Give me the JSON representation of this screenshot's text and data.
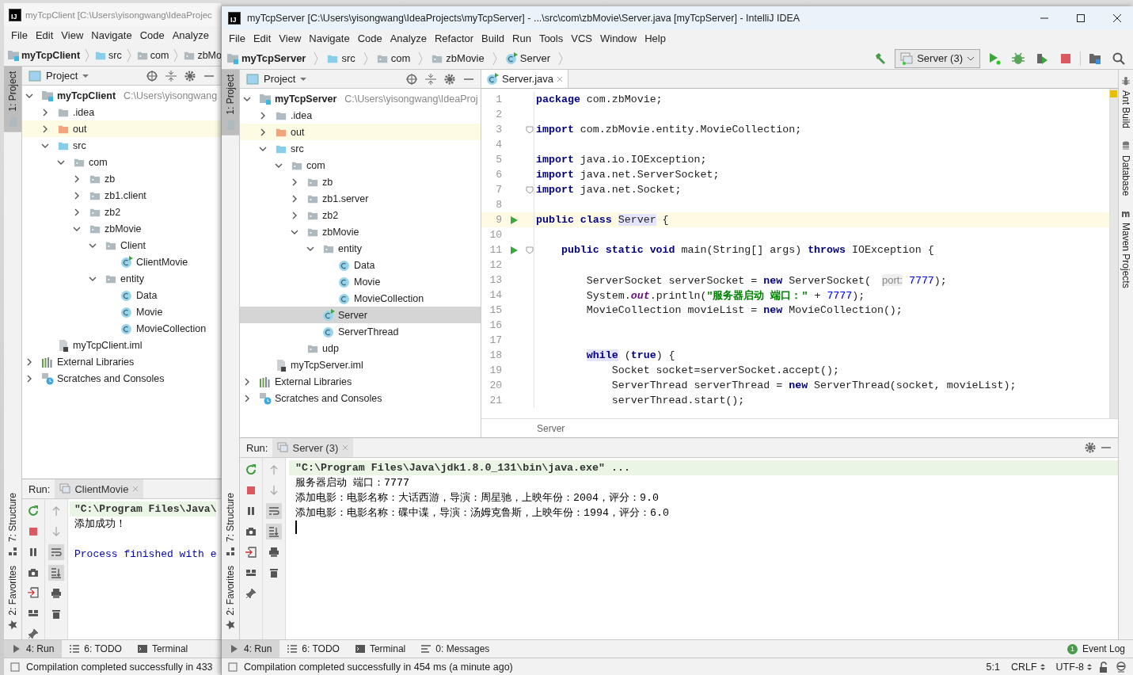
{
  "back_window": {
    "logo_text": "IJ",
    "title": "myTcpClient [C:\\Users\\yisongwang\\IdeaProjec",
    "menu": [
      "File",
      "Edit",
      "View",
      "Navigate",
      "Code",
      "Analyze"
    ],
    "breadcrumbs": [
      {
        "label": "myTcpClient",
        "kind": "module"
      },
      {
        "label": "src",
        "kind": "source"
      },
      {
        "label": "com",
        "kind": "package"
      },
      {
        "label": "zbMo",
        "kind": "package"
      }
    ],
    "side_tabs": [
      {
        "label": "1: Project",
        "kind": "folder",
        "selected": true
      },
      {
        "label": "7: Structure",
        "kind": "structure",
        "selected": false
      },
      {
        "label": "2: Favorites",
        "kind": "star",
        "selected": false
      }
    ],
    "project_panel": {
      "title": "Project"
    },
    "project_tree": [
      {
        "label": "myTcpClient",
        "kind": "module",
        "expanded": true,
        "hint": "C:\\Users\\yisongwang",
        "children": [
          {
            "label": ".idea",
            "kind": "folder",
            "expanded": false
          },
          {
            "label": "out",
            "kind": "excluded",
            "expanded": false
          },
          {
            "label": "src",
            "kind": "source",
            "expanded": true,
            "children": [
              {
                "label": "com",
                "kind": "package",
                "expanded": true,
                "children": [
                  {
                    "label": "zb",
                    "kind": "package",
                    "expanded": false
                  },
                  {
                    "label": "zb1.client",
                    "kind": "package",
                    "expanded": false
                  },
                  {
                    "label": "zb2",
                    "kind": "package",
                    "expanded": false
                  },
                  {
                    "label": "zbMovie",
                    "kind": "package",
                    "expanded": true,
                    "children": [
                      {
                        "label": "Client",
                        "kind": "package",
                        "expanded": true,
                        "children": [
                          {
                            "label": "ClientMovie",
                            "kind": "run-class"
                          }
                        ]
                      },
                      {
                        "label": "entity",
                        "kind": "package",
                        "expanded": true,
                        "children": [
                          {
                            "label": "Data",
                            "kind": "class"
                          },
                          {
                            "label": "Movie",
                            "kind": "class"
                          },
                          {
                            "label": "MovieCollection",
                            "kind": "class"
                          }
                        ]
                      }
                    ]
                  }
                ]
              }
            ]
          },
          {
            "label": "myTcpClient.iml",
            "kind": "iml"
          }
        ]
      },
      {
        "label": "External Libraries",
        "kind": "libraries",
        "expanded": false
      },
      {
        "label": "Scratches and Consoles",
        "kind": "scratches",
        "expanded": false
      }
    ],
    "run_panel": {
      "label": "Run:",
      "tab": "ClientMovie"
    },
    "console": [
      {
        "text": "\"C:\\Program Files\\Java\\",
        "kind": "command"
      },
      {
        "text": "添加成功！",
        "kind": "output"
      },
      {
        "text": "Process finished with e",
        "kind": "process"
      }
    ],
    "bottom_tabs": [
      {
        "label": "4: Run",
        "kind": "run",
        "selected": true
      },
      {
        "label": "6: TODO",
        "kind": "todo",
        "selected": false
      },
      {
        "label": "Terminal",
        "kind": "terminal",
        "selected": false
      }
    ],
    "status": "Compilation completed successfully in 433"
  },
  "front_window": {
    "logo_text": "IJ",
    "title": "myTcpServer [C:\\Users\\yisongwang\\IdeaProjects\\myTcpServer] - ...\\src\\com\\zbMovie\\Server.java [myTcpServer] - IntelliJ IDEA",
    "menu": [
      "File",
      "Edit",
      "View",
      "Navigate",
      "Code",
      "Analyze",
      "Refactor",
      "Build",
      "Run",
      "Tools",
      "VCS",
      "Window",
      "Help"
    ],
    "breadcrumbs": [
      {
        "label": "myTcpServer",
        "kind": "module"
      },
      {
        "label": "src",
        "kind": "source"
      },
      {
        "label": "com",
        "kind": "package"
      },
      {
        "label": "zbMovie",
        "kind": "package"
      },
      {
        "label": "Server",
        "kind": "run-class"
      }
    ],
    "run_config": "Server (3)",
    "side_tabs": [
      {
        "label": "1: Project",
        "kind": "folder",
        "selected": true
      },
      {
        "label": "7: Structure",
        "kind": "structure",
        "selected": false
      },
      {
        "label": "2: Favorites",
        "kind": "star",
        "selected": false
      }
    ],
    "right_tabs": [
      {
        "label": "Ant Build",
        "kind": "ant"
      },
      {
        "label": "Database",
        "kind": "database"
      },
      {
        "label": "Maven Projects",
        "kind": "maven"
      }
    ],
    "project_panel": {
      "title": "Project"
    },
    "project_tree": [
      {
        "label": "myTcpServer",
        "kind": "module",
        "expanded": true,
        "selected": false,
        "hint": "C:\\Users\\yisongwang\\IdeaProj",
        "children": [
          {
            "label": ".idea",
            "kind": "folder",
            "expanded": false,
            "selected": false
          },
          {
            "label": "out",
            "kind": "excluded",
            "expanded": false,
            "selected": false
          },
          {
            "label": "src",
            "kind": "source",
            "expanded": true,
            "selected": false,
            "children": [
              {
                "label": "com",
                "kind": "package",
                "expanded": true,
                "selected": false,
                "children": [
                  {
                    "label": "zb",
                    "kind": "package",
                    "expanded": false,
                    "selected": false
                  },
                  {
                    "label": "zb1.server",
                    "kind": "package",
                    "expanded": false,
                    "selected": false
                  },
                  {
                    "label": "zb2",
                    "kind": "package",
                    "expanded": false,
                    "selected": false
                  },
                  {
                    "label": "zbMovie",
                    "kind": "package",
                    "expanded": true,
                    "selected": false,
                    "children": [
                      {
                        "label": "entity",
                        "kind": "package",
                        "expanded": true,
                        "selected": false,
                        "children": [
                          {
                            "label": "Data",
                            "kind": "class",
                            "selected": false
                          },
                          {
                            "label": "Movie",
                            "kind": "class",
                            "selected": false
                          },
                          {
                            "label": "MovieCollection",
                            "kind": "class",
                            "selected": false
                          }
                        ]
                      },
                      {
                        "label": "Server",
                        "kind": "run-class",
                        "selected": true
                      },
                      {
                        "label": "ServerThread",
                        "kind": "class",
                        "selected": false
                      }
                    ]
                  },
                  {
                    "label": "udp",
                    "kind": "package",
                    "selected": false
                  }
                ]
              }
            ]
          },
          {
            "label": "myTcpServer.iml",
            "kind": "iml",
            "selected": false
          }
        ]
      },
      {
        "label": "External Libraries",
        "kind": "libraries",
        "expanded": false,
        "selected": false
      },
      {
        "label": "Scratches and Consoles",
        "kind": "scratches",
        "expanded": false,
        "selected": false
      }
    ],
    "editor_tab": "Server.java",
    "code": [
      {
        "number": "1",
        "current": false,
        "run": false,
        "fold": false,
        "tokens": [
          {
            "text": "package",
            "kind": "kw"
          },
          {
            "text": " com.zbMovie;",
            "kind": "plain"
          }
        ]
      },
      {
        "number": "2",
        "current": false,
        "run": false,
        "fold": false
      },
      {
        "number": "3",
        "current": false,
        "run": false,
        "fold": true,
        "tokens": [
          {
            "text": "import",
            "kind": "kw"
          },
          {
            "text": " com.zbMovie.entity.MovieCollection;",
            "kind": "plain"
          }
        ]
      },
      {
        "number": "4",
        "current": false,
        "run": false,
        "fold": false
      },
      {
        "number": "5",
        "current": false,
        "run": false,
        "fold": false,
        "tokens": [
          {
            "text": "import",
            "kind": "kw"
          },
          {
            "text": " java.io.IOException;",
            "kind": "plain"
          }
        ]
      },
      {
        "number": "6",
        "current": false,
        "run": false,
        "fold": false,
        "tokens": [
          {
            "text": "import",
            "kind": "kw"
          },
          {
            "text": " java.net.ServerSocket;",
            "kind": "plain"
          }
        ]
      },
      {
        "number": "7",
        "current": false,
        "run": false,
        "fold": true,
        "tokens": [
          {
            "text": "import",
            "kind": "kw"
          },
          {
            "text": " java.net.Socket;",
            "kind": "plain"
          }
        ]
      },
      {
        "number": "8",
        "current": false,
        "run": false,
        "fold": false
      },
      {
        "number": "9",
        "current": true,
        "run": true,
        "fold": false,
        "tokens": [
          {
            "text": "public class ",
            "kind": "kw"
          },
          {
            "text": "Server",
            "kind": "usage"
          },
          {
            "text": " {",
            "kind": "plain"
          }
        ]
      },
      {
        "number": "10",
        "current": false,
        "run": false,
        "fold": false
      },
      {
        "number": "11",
        "current": false,
        "run": true,
        "fold": true,
        "tokens": [
          {
            "text": "    public static void",
            "kind": "kw"
          },
          {
            "text": " main(String[] args) ",
            "kind": "plain"
          },
          {
            "text": "throws",
            "kind": "kw"
          },
          {
            "text": " IOException {",
            "kind": "plain"
          }
        ]
      },
      {
        "number": "12",
        "current": false,
        "run": false,
        "fold": false
      },
      {
        "number": "13",
        "current": false,
        "run": false,
        "fold": false,
        "tokens": [
          {
            "text": "        ServerSocket serverSocket = ",
            "kind": "plain"
          },
          {
            "text": "new",
            "kind": "kw"
          },
          {
            "text": " ServerSocket( ",
            "kind": "plain"
          },
          {
            "text": "port:",
            "kind": "hint"
          },
          {
            "text": " 7777",
            "kind": "num"
          },
          {
            "text": ");",
            "kind": "plain"
          }
        ]
      },
      {
        "number": "14",
        "current": false,
        "run": false,
        "fold": false,
        "tokens": [
          {
            "text": "        System.",
            "kind": "plain"
          },
          {
            "text": "out",
            "kind": "field"
          },
          {
            "text": ".println(",
            "kind": "plain"
          },
          {
            "text": "\"服务器启动 端口：\"",
            "kind": "str"
          },
          {
            "text": " + ",
            "kind": "plain"
          },
          {
            "text": "7777",
            "kind": "num"
          },
          {
            "text": ");",
            "kind": "plain"
          }
        ]
      },
      {
        "number": "15",
        "current": false,
        "run": false,
        "fold": false,
        "tokens": [
          {
            "text": "        MovieCollection movieList = ",
            "kind": "plain"
          },
          {
            "text": "new",
            "kind": "kw"
          },
          {
            "text": " MovieCollection();",
            "kind": "plain"
          }
        ]
      },
      {
        "number": "16",
        "current": false,
        "run": false,
        "fold": false
      },
      {
        "number": "17",
        "current": false,
        "run": false,
        "fold": false
      },
      {
        "number": "18",
        "current": false,
        "run": false,
        "fold": false,
        "tokens": [
          {
            "text": "        while",
            "kind": "kw-hl"
          },
          {
            "text": " (",
            "kind": "plain"
          },
          {
            "text": "true",
            "kind": "kw"
          },
          {
            "text": ") {",
            "kind": "plain"
          }
        ]
      },
      {
        "number": "19",
        "current": false,
        "run": false,
        "fold": false,
        "tokens": [
          {
            "text": "            Socket socket=serverSocket.accept();",
            "kind": "plain"
          }
        ]
      },
      {
        "number": "20",
        "current": false,
        "run": false,
        "fold": false,
        "tokens": [
          {
            "text": "            ServerThread serverThread = ",
            "kind": "plain"
          },
          {
            "text": "new",
            "kind": "kw"
          },
          {
            "text": " ServerThread(socket, movieList);",
            "kind": "plain"
          }
        ]
      },
      {
        "number": "21",
        "current": false,
        "run": false,
        "fold": false,
        "tokens": [
          {
            "text": "            serverThread.start();",
            "kind": "plain"
          }
        ]
      }
    ],
    "editor_footer": "Server",
    "run_panel": {
      "label": "Run:",
      "tab": "Server (3)"
    },
    "console": [
      {
        "text": "\"C:\\Program Files\\Java\\jdk1.8.0_131\\bin\\java.exe\" ...",
        "kind": "command"
      },
      {
        "text": "服务器启动 端口：7777",
        "kind": "output"
      },
      {
        "text": "添加电影：电影名称：大话西游，导演：周星驰，上映年份：2004，评分：9.0",
        "kind": "output"
      },
      {
        "text": "添加电影：电影名称：碟中谍，导演：汤姆克鲁斯，上映年份：1994，评分：6.0",
        "kind": "output"
      }
    ],
    "bottom_tabs": [
      {
        "label": "4: Run",
        "kind": "run",
        "selected": true
      },
      {
        "label": "6: TODO",
        "kind": "todo",
        "selected": false
      },
      {
        "label": "Terminal",
        "kind": "terminal",
        "selected": false
      },
      {
        "label": "0: Messages",
        "kind": "messages",
        "selected": false
      }
    ],
    "event_log": {
      "count": "1",
      "label": "Event Log"
    },
    "status": "Compilation completed successfully in 454 ms (a minute ago)",
    "position": "5:1",
    "line_separator": "CRLF",
    "encoding": "UTF-8"
  }
}
